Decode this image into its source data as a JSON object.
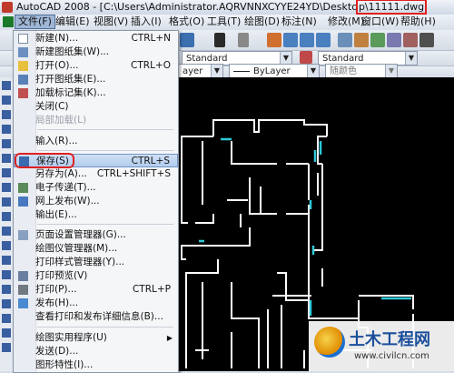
{
  "window": {
    "title_prefix": "AutoCAD 2008 - [C:\\Users\\Administrator.AQRVNNXCYYE24YD\\Deskto",
    "title_highlight": "p\\11111.dwg"
  },
  "menubar": {
    "items": [
      {
        "label": "文件(F)",
        "active": true
      },
      {
        "label": "编辑(E)"
      },
      {
        "label": "视图(V)"
      },
      {
        "label": "插入(I)"
      },
      {
        "label": "格式(O)"
      },
      {
        "label": "工具(T)"
      },
      {
        "label": "绘图(D)"
      },
      {
        "label": "标注(N)"
      },
      {
        "label": "修改(M)"
      },
      {
        "label": "窗口(W)"
      },
      {
        "label": "帮助(H)"
      }
    ]
  },
  "toolbar": {
    "text_style": "Standard",
    "dim_style": "Standard",
    "linetype": "ByLayer",
    "layer_partial": "ayer",
    "color": "随颜色"
  },
  "file_menu": {
    "items": [
      {
        "label": "新建(N)...",
        "shortcut": "CTRL+N",
        "icon": "new-file-icon"
      },
      {
        "label": "新建图纸集(W)...",
        "icon": "new-sheetset-icon"
      },
      {
        "label": "打开(O)...",
        "shortcut": "CTRL+O",
        "icon": "open-folder-icon"
      },
      {
        "label": "打开图纸集(E)...",
        "icon": "open-sheetset-icon"
      },
      {
        "label": "加载标记集(K)...",
        "icon": "markup-icon"
      },
      {
        "label": "关闭(C)"
      },
      {
        "label": "局部加载(L)",
        "disabled": true
      },
      {
        "label": "输入(R)..."
      },
      {
        "label": "保存(S)",
        "shortcut": "CTRL+S",
        "icon": "save-icon",
        "highlighted": true
      },
      {
        "label": "另存为(A)...",
        "shortcut": "CTRL+SHIFT+S"
      },
      {
        "label": "电子传递(T)...",
        "icon": "etransmit-icon"
      },
      {
        "label": "网上发布(W)...",
        "icon": "publish-web-icon"
      },
      {
        "label": "输出(E)..."
      },
      {
        "label": "页面设置管理器(G)...",
        "icon": "page-setup-icon"
      },
      {
        "label": "绘图仪管理器(M)..."
      },
      {
        "label": "打印样式管理器(Y)..."
      },
      {
        "label": "打印预览(V)",
        "icon": "print-preview-icon"
      },
      {
        "label": "打印(P)...",
        "shortcut": "CTRL+P",
        "icon": "print-icon"
      },
      {
        "label": "发布(H)...",
        "icon": "publish-icon"
      },
      {
        "label": "查看打印和发布详细信息(B)..."
      },
      {
        "label": "绘图实用程序(U)",
        "submenu": true
      },
      {
        "label": "发送(D)..."
      },
      {
        "label": "图形特性(I)..."
      }
    ]
  },
  "watermark": {
    "title": "土木工程网",
    "url": "www.civilcn.com"
  },
  "colors": {
    "drawing_bg": "#000000",
    "wall_line": "#ffffff",
    "window_line": "#2ec8d8",
    "highlight_ring": "#e02020",
    "menu_highlight": "#b3cdee"
  }
}
